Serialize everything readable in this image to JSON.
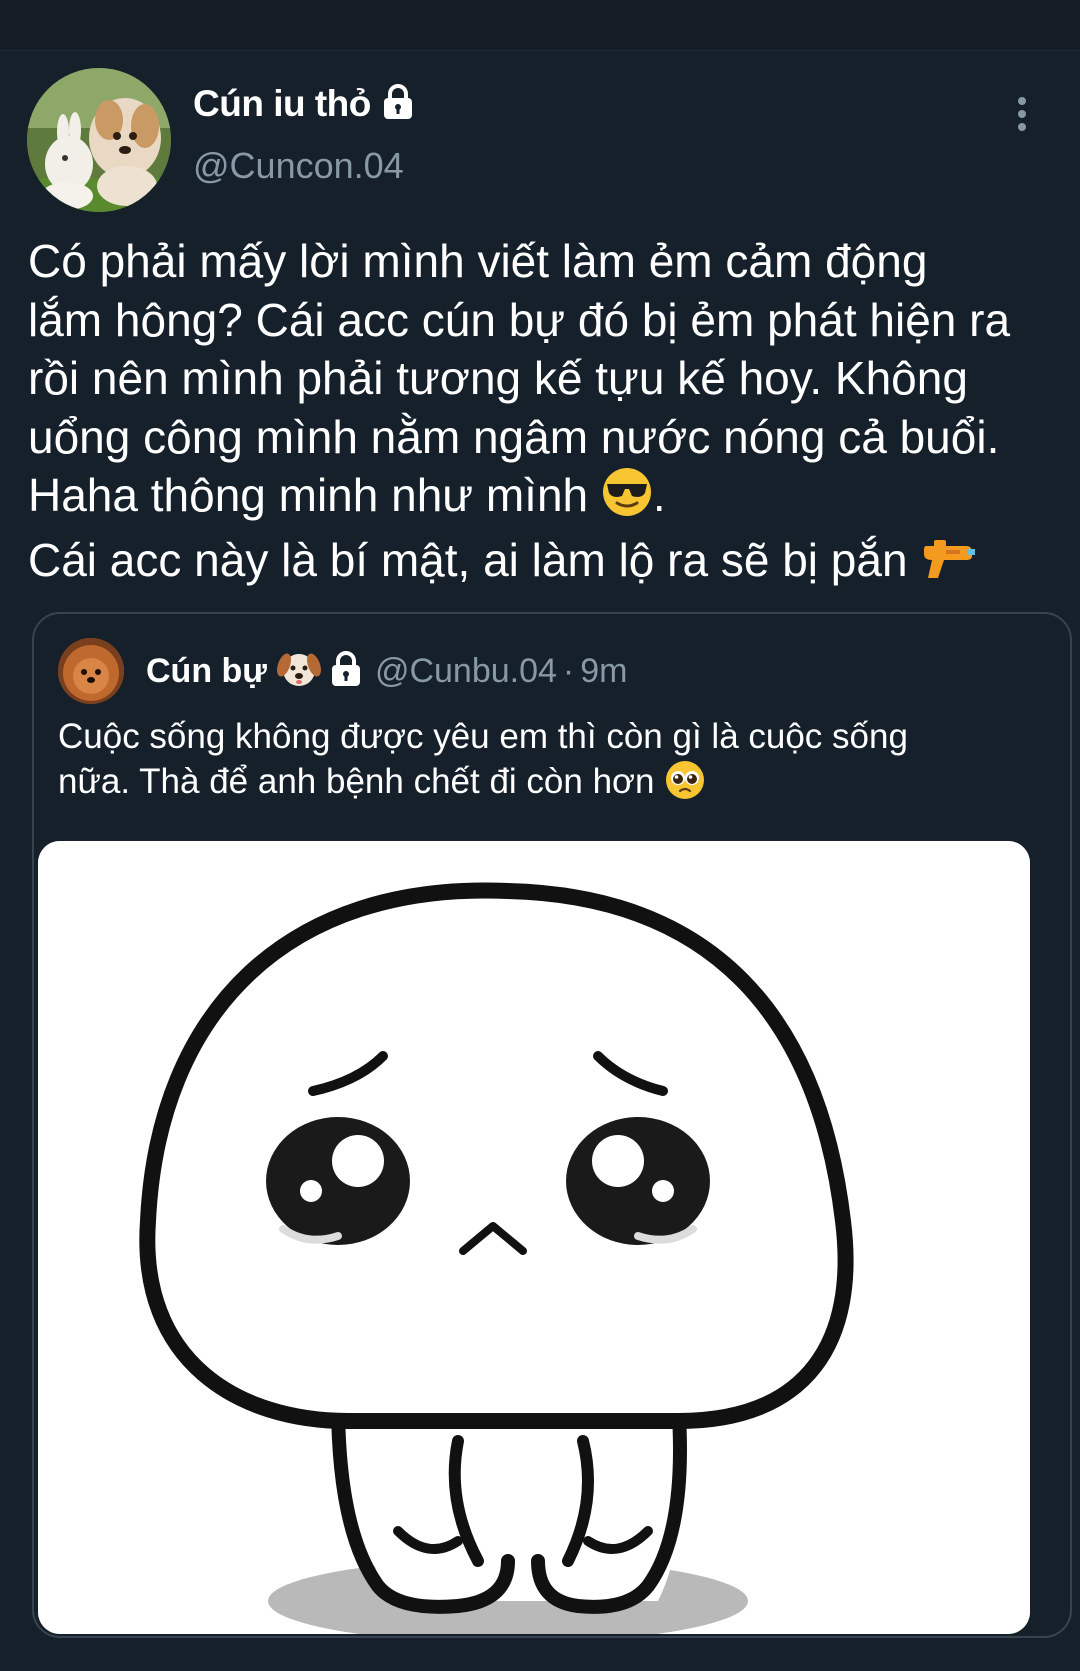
{
  "tweet": {
    "author": {
      "display_name": "Cún iu thỏ",
      "handle": "@Cuncon.04",
      "protected": true
    },
    "text_lines": [
      "Có phải mấy lời mình viết làm ẻm cảm động",
      "lắm hông? Cái acc cún bự đó bị ẻm phát hiện ra",
      "rồi nên mình phải tương kế tựu kế hoy. Không",
      "uổng công mình nằm ngâm nước nóng cả buổi.",
      "Haha thông minh như mình",
      "Cái acc này là bí mật, ai làm lộ ra sẽ bị pắn"
    ],
    "line5_suffix": ".",
    "icons": {
      "more": "more-vertical-icon",
      "lock": "lock-icon",
      "sunglasses": "sunglasses-emoji-icon",
      "water_gun": "water-pistol-emoji-icon"
    }
  },
  "quoted_tweet": {
    "display_name": "Cún bự",
    "handle": "@Cunbu.04",
    "separator": "·",
    "time": "9m",
    "text_lines": [
      "Cuộc sống không được yêu em thì còn gì là cuộc sống",
      "nữa. Thà để anh bệnh chết đi còn hơn"
    ],
    "icons": {
      "dog_face": "dog-face-emoji-icon",
      "lock": "lock-icon",
      "pleading": "pleading-face-emoji-icon"
    },
    "image": "sad-cartoon-character-image"
  },
  "colors": {
    "background": "#15202b",
    "text": "#ffffff",
    "secondary": "#8899a6",
    "border": "#38444d"
  }
}
